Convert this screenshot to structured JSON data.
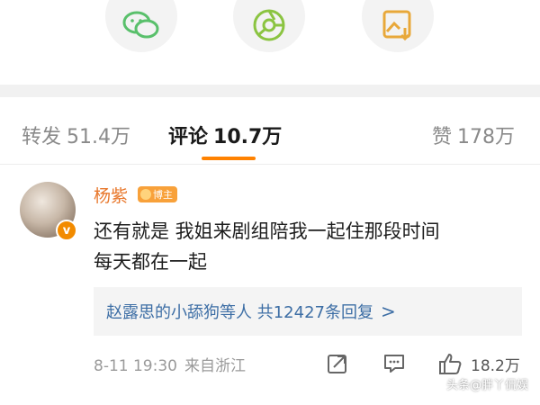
{
  "share_icons": [
    "wechat-icon",
    "moments-icon",
    "save-image-icon"
  ],
  "tabs": {
    "repost": {
      "label": "转发",
      "count": "51.4万"
    },
    "comments": {
      "label": "评论",
      "count": "10.7万"
    },
    "likes": {
      "label": "赞",
      "count": "178万"
    }
  },
  "comment": {
    "username": "杨紫",
    "badge": "博主",
    "text_line1": "还有就是 我姐来剧组陪我一起住那段时间",
    "text_line2": "每天都在一起",
    "replies_text": "赵露思的小舔狗等人 共12427条回复",
    "replies_chevron": ">",
    "date": "8-11 19:30",
    "location": "来自浙江",
    "like_count": "18.2万"
  },
  "colors": {
    "accent": "#ff8200",
    "username": "#e8772b",
    "link": "#3d6ea5"
  },
  "watermark": "头条@胖丫侃娱"
}
